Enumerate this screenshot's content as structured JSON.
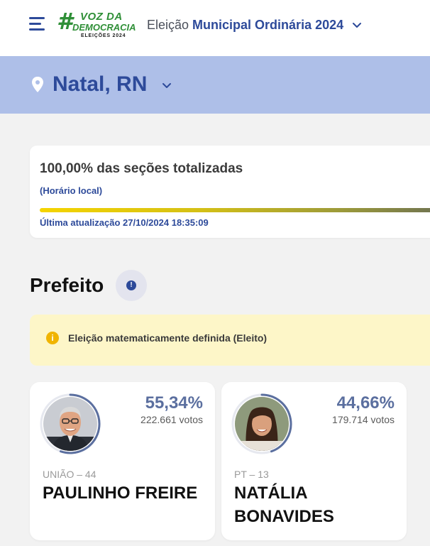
{
  "header": {
    "logo": {
      "hash": "#",
      "line1": "VOZ DA",
      "line2": "DEMOCRACIA",
      "line3": "ELEIÇÕES 2024"
    },
    "election_prefix": "Eleição",
    "election_name": "Municipal Ordinária 2024"
  },
  "location": {
    "city": "Natal, RN"
  },
  "status": {
    "title": "100,00% das seções totalizadas",
    "local_time": "(Horário local)",
    "progress_percent": 100,
    "last_update": "Última atualização 27/10/2024 18:35:09"
  },
  "race": {
    "title": "Prefeito",
    "info_icon": "exclamation-icon",
    "alert_text": "Eleição matematicamente definida (Eleito)"
  },
  "candidates": [
    {
      "percent": "55,34%",
      "percent_value": 55.34,
      "votes": "222.661 votos",
      "party": "UNIÃO – 44",
      "name": "PAULINHO FREIRE",
      "ring_color": "#5b6f9f"
    },
    {
      "percent": "44,66%",
      "percent_value": 44.66,
      "votes": "179.714 votos",
      "party": "PT – 13",
      "name": "NATÁLIA BONAVIDES",
      "ring_color": "#5b6f9f"
    }
  ],
  "colors": {
    "brand_blue": "#2d4a9a",
    "band": "#aebfe8",
    "alert_bg": "#fdf6c8",
    "logo_green": "#2f8f37"
  }
}
